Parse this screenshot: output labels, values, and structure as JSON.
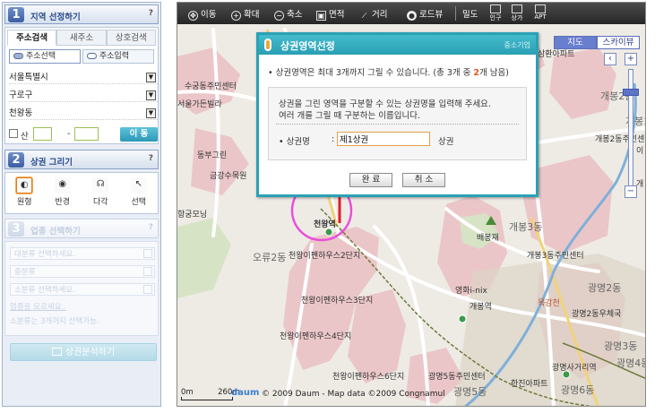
{
  "left_panel": {
    "step1": {
      "num": "1",
      "title": "지역 선정하기",
      "help": "?",
      "tabs": [
        {
          "label": "주소검색"
        },
        {
          "label": "새주소"
        },
        {
          "label": "상호검색"
        }
      ],
      "modes": {
        "select": "주소선택",
        "input": "주소입력"
      },
      "selects": {
        "city": "서울특별시",
        "district": "구로구",
        "dong": "천왕동"
      },
      "mountain_label": "산",
      "dash": "-",
      "move_button": "이 동"
    },
    "step2": {
      "num": "2",
      "title": "상권 그리기",
      "help": "?",
      "tools": [
        {
          "label": "원형"
        },
        {
          "label": "반경"
        },
        {
          "label": "다각"
        },
        {
          "label": "선택"
        }
      ]
    },
    "step3": {
      "num": "3",
      "title": "업종 선택하기",
      "help": "?",
      "rows": [
        "대분류 선택하세요.",
        "중분류",
        "소분류 선택하세요."
      ],
      "link": "업종을 모르세요..",
      "note": "소분류는 3개까지 선택가능."
    },
    "analyze_button": "상권분석하기"
  },
  "map": {
    "toolbar": {
      "move": "이동",
      "zoom_in": "확대",
      "zoom_out": "축소",
      "area": "면적",
      "distance": "거리",
      "roadview": "로드뷰",
      "density": "밀도",
      "pop": "인구",
      "shop": "상가",
      "apt": "APT"
    },
    "map_type": {
      "map": "지도",
      "sky": "스카이뷰"
    },
    "nav": {
      "left": "‹",
      "up": "^",
      "right": "›",
      "down": "v",
      "plus": "+",
      "minus": "−"
    },
    "labels": {
      "l1": "수궁동주민센터",
      "l2": "서울가든빌라",
      "l3": "동부그린",
      "l4": "금강수목원",
      "l5": "항궁모닝",
      "l6": "천왕역",
      "l7": "오류2동",
      "l8": "천왕이펜하우스2단지",
      "l9": "천왕이펜하우스3단지",
      "l10": "천왕이펜하우스4단지",
      "l11": "천왕이펜하우스6단지",
      "l12": "배봉재",
      "l13": "개봉3동",
      "l14": "개봉3동주민센터",
      "l15": "영화i-nix",
      "l16": "목감천",
      "l17": "개봉2동",
      "l18": "개봉2동주민센터",
      "l19": "광명2동",
      "l20": "광명2동우체국",
      "l21": "광명3동",
      "l22": "광명사거리역",
      "l23": "광명5동주민센터",
      "l24": "한진아파트",
      "l25": "광명6동",
      "l26": "광명5동",
      "l27": "삼환아파트",
      "l28": "개봉1",
      "l29": "개",
      "l30": "이",
      "l31": "광명4동",
      "l32": "개봉역"
    },
    "scale": {
      "left": "0m",
      "right": "260m"
    },
    "logo": "daum",
    "copyright": "© 2009 Daum - Map data ©2009 Congnamul"
  },
  "dialog": {
    "title": "상권영역선정",
    "brand": "중소기업",
    "notice_prefix": "• 상권영역은 최대 3개까지 그릴 수 있습니다. (총 3개 중 ",
    "notice_count": "2",
    "notice_suffix": "개 남음)",
    "desc1": "상권을 그린 영역을 구분할 수 있는 상권명을 입력해 주세요.",
    "desc2": "여러 개를 그릴 때 구분하는 이름입니다.",
    "field_label": "• 상권명",
    "field_colon": ":",
    "field_value": "제1상권",
    "field_suffix": "상권",
    "ok": "완 료",
    "cancel": "취 소"
  },
  "colors": {
    "accent": "#2aa1b5",
    "circle": "#e84fd8",
    "arrow": "#e11d2a",
    "panel_blue": "#3b5ea4"
  }
}
